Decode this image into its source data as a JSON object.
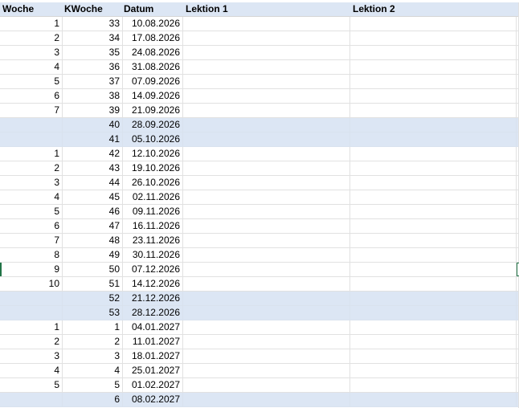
{
  "headers": {
    "woche": "Woche",
    "kwoche": "KWoche",
    "datum": "Datum",
    "lektion1": "Lektion 1",
    "lektion2": "Lektion 2"
  },
  "rows": [
    {
      "woche": "1",
      "kwoche": "33",
      "datum": "10.08.2026",
      "lektion1": "",
      "lektion2": "",
      "holiday": false
    },
    {
      "woche": "2",
      "kwoche": "34",
      "datum": "17.08.2026",
      "lektion1": "",
      "lektion2": "",
      "holiday": false
    },
    {
      "woche": "3",
      "kwoche": "35",
      "datum": "24.08.2026",
      "lektion1": "",
      "lektion2": "",
      "holiday": false
    },
    {
      "woche": "4",
      "kwoche": "36",
      "datum": "31.08.2026",
      "lektion1": "",
      "lektion2": "",
      "holiday": false
    },
    {
      "woche": "5",
      "kwoche": "37",
      "datum": "07.09.2026",
      "lektion1": "",
      "lektion2": "",
      "holiday": false
    },
    {
      "woche": "6",
      "kwoche": "38",
      "datum": "14.09.2026",
      "lektion1": "",
      "lektion2": "",
      "holiday": false
    },
    {
      "woche": "7",
      "kwoche": "39",
      "datum": "21.09.2026",
      "lektion1": "",
      "lektion2": "",
      "holiday": false
    },
    {
      "woche": "",
      "kwoche": "40",
      "datum": "28.09.2026",
      "lektion1": "",
      "lektion2": "",
      "holiday": true
    },
    {
      "woche": "",
      "kwoche": "41",
      "datum": "05.10.2026",
      "lektion1": "",
      "lektion2": "",
      "holiday": true
    },
    {
      "woche": "1",
      "kwoche": "42",
      "datum": "12.10.2026",
      "lektion1": "",
      "lektion2": "",
      "holiday": false
    },
    {
      "woche": "2",
      "kwoche": "43",
      "datum": "19.10.2026",
      "lektion1": "",
      "lektion2": "",
      "holiday": false
    },
    {
      "woche": "3",
      "kwoche": "44",
      "datum": "26.10.2026",
      "lektion1": "",
      "lektion2": "",
      "holiday": false
    },
    {
      "woche": "4",
      "kwoche": "45",
      "datum": "02.11.2026",
      "lektion1": "",
      "lektion2": "",
      "holiday": false
    },
    {
      "woche": "5",
      "kwoche": "46",
      "datum": "09.11.2026",
      "lektion1": "",
      "lektion2": "",
      "holiday": false
    },
    {
      "woche": "6",
      "kwoche": "47",
      "datum": "16.11.2026",
      "lektion1": "",
      "lektion2": "",
      "holiday": false
    },
    {
      "woche": "7",
      "kwoche": "48",
      "datum": "23.11.2026",
      "lektion1": "",
      "lektion2": "",
      "holiday": false
    },
    {
      "woche": "8",
      "kwoche": "49",
      "datum": "30.11.2026",
      "lektion1": "",
      "lektion2": "",
      "holiday": false
    },
    {
      "woche": "9",
      "kwoche": "50",
      "datum": "07.12.2026",
      "lektion1": "",
      "lektion2": "",
      "holiday": false
    },
    {
      "woche": "10",
      "kwoche": "51",
      "datum": "14.12.2026",
      "lektion1": "",
      "lektion2": "",
      "holiday": false
    },
    {
      "woche": "",
      "kwoche": "52",
      "datum": "21.12.2026",
      "lektion1": "",
      "lektion2": "",
      "holiday": true
    },
    {
      "woche": "",
      "kwoche": "53",
      "datum": "28.12.2026",
      "lektion1": "",
      "lektion2": "",
      "holiday": true
    },
    {
      "woche": "1",
      "kwoche": "1",
      "datum": "04.01.2027",
      "lektion1": "",
      "lektion2": "",
      "holiday": false
    },
    {
      "woche": "2",
      "kwoche": "2",
      "datum": "11.01.2027",
      "lektion1": "",
      "lektion2": "",
      "holiday": false
    },
    {
      "woche": "3",
      "kwoche": "3",
      "datum": "18.01.2027",
      "lektion1": "",
      "lektion2": "",
      "holiday": false
    },
    {
      "woche": "4",
      "kwoche": "4",
      "datum": "25.01.2027",
      "lektion1": "",
      "lektion2": "",
      "holiday": false
    },
    {
      "woche": "5",
      "kwoche": "5",
      "datum": "01.02.2027",
      "lektion1": "",
      "lektion2": "",
      "holiday": false
    },
    {
      "woche": "",
      "kwoche": "6",
      "datum": "08.02.2027",
      "lektion1": "",
      "lektion2": "",
      "holiday": true
    }
  ],
  "colors": {
    "header_fill": "#dce6f4",
    "holiday_fill": "#dce6f4",
    "gridline": "#e1e1e1",
    "selection": "#217346"
  }
}
